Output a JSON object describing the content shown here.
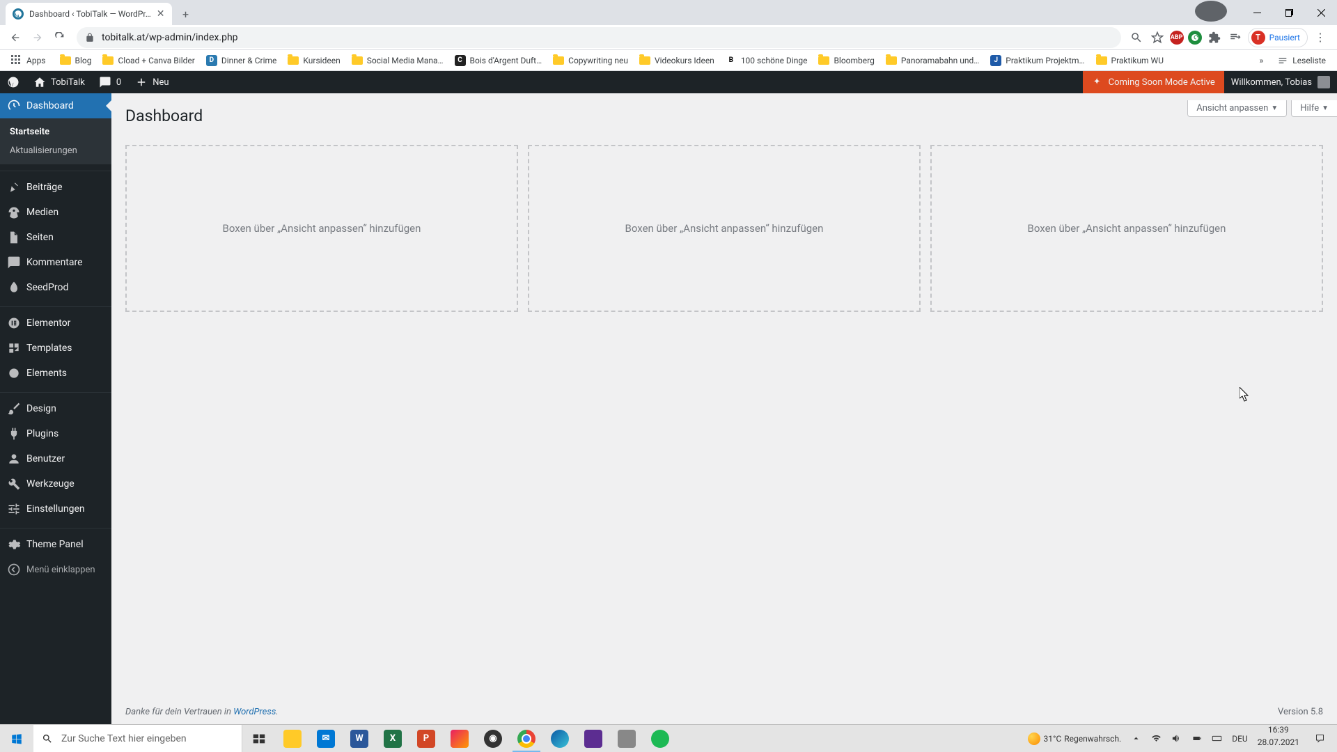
{
  "browser": {
    "tab_title": "Dashboard ‹ TobiTalk — WordPr…",
    "url": "tobitalk.at/wp-admin/index.php",
    "profile_status": "Pausiert",
    "apps_label": "Apps",
    "reading_list": "Leseliste",
    "bookmarks": [
      {
        "label": "Blog",
        "type": "folder"
      },
      {
        "label": "Cload + Canva Bilder",
        "type": "folder"
      },
      {
        "label": "Dinner & Crime",
        "type": "site",
        "bg": "#2a7ab0",
        "initial": "D"
      },
      {
        "label": "Kursideen",
        "type": "folder"
      },
      {
        "label": "Social Media Mana…",
        "type": "folder"
      },
      {
        "label": "Bois d'Argent Duft…",
        "type": "site",
        "bg": "#222",
        "initial": "C"
      },
      {
        "label": "Copywriting neu",
        "type": "folder"
      },
      {
        "label": "Videokurs Ideen",
        "type": "folder"
      },
      {
        "label": "100 schöne Dinge",
        "type": "site",
        "bg": "#fff",
        "initial": "B",
        "color": "#000"
      },
      {
        "label": "Bloomberg",
        "type": "folder"
      },
      {
        "label": "Panoramabahn und…",
        "type": "folder"
      },
      {
        "label": "Praktikum Projektm…",
        "type": "site",
        "bg": "#1e5aa8",
        "initial": "J"
      },
      {
        "label": "Praktikum WU",
        "type": "folder"
      }
    ]
  },
  "adminbar": {
    "site_name": "TobiTalk",
    "comments_count": "0",
    "new_label": "Neu",
    "coming_soon": "Coming Soon Mode Active",
    "greeting": "Willkommen, Tobias"
  },
  "sidebar": {
    "dashboard": "Dashboard",
    "sub_home": "Startseite",
    "sub_updates": "Aktualisierungen",
    "posts": "Beiträge",
    "media": "Medien",
    "pages": "Seiten",
    "comments": "Kommentare",
    "seedprod": "SeedProd",
    "elementor": "Elementor",
    "templates": "Templates",
    "elements": "Elements",
    "design": "Design",
    "plugins": "Plugins",
    "users": "Benutzer",
    "tools": "Werkzeuge",
    "settings": "Einstellungen",
    "theme_panel": "Theme Panel",
    "collapse": "Menü einklappen"
  },
  "content": {
    "page_title": "Dashboard",
    "screen_options": "Ansicht anpassen",
    "help": "Hilfe",
    "empty_box_hint": "Boxen über „Ansicht anpassen“ hinzufügen",
    "footer_thanks": "Danke für dein Vertrauen in ",
    "footer_link": "WordPress",
    "version": "Version 5.8"
  },
  "taskbar": {
    "search_placeholder": "Zur Suche Text hier eingeben",
    "weather_temp": "31°C",
    "weather_text": "Regenwahrsch.",
    "lang": "DEU",
    "time": "16:39",
    "date": "28.07.2021"
  }
}
